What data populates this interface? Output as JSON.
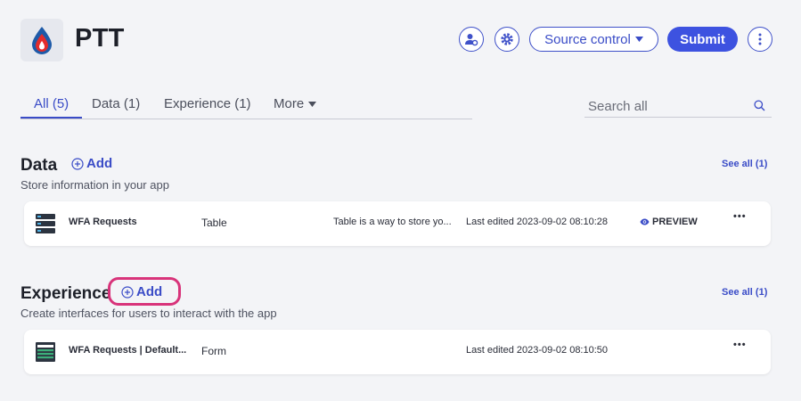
{
  "header": {
    "title": "PTT",
    "source_control_label": "Source control",
    "submit_label": "Submit"
  },
  "tabs": [
    {
      "label": "All (5)",
      "active": true
    },
    {
      "label": "Data (1)",
      "active": false
    },
    {
      "label": "Experience (1)",
      "active": false
    },
    {
      "label": "More",
      "active": false
    }
  ],
  "search": {
    "placeholder": "Search all"
  },
  "data_section": {
    "title": "Data",
    "add_label": "Add",
    "description": "Store information in your app",
    "see_all": "See all (1)",
    "items": [
      {
        "name": "WFA Requests",
        "type": "Table",
        "description": "Table is a way to store yo...",
        "edited": "Last edited 2023-09-02 08:10:28",
        "preview_label": "PREVIEW",
        "more": "•••"
      }
    ]
  },
  "experience_section": {
    "title": "Experience",
    "add_label": "Add",
    "description": "Create interfaces for users to interact with the app",
    "see_all": "See all (1)",
    "items": [
      {
        "name": "WFA Requests | Default...",
        "type": "Form",
        "edited": "Last edited 2023-09-02 08:10:50",
        "more": "•••"
      }
    ]
  },
  "colors": {
    "accent": "#3a4cc7",
    "submit": "#3d52e0",
    "highlight": "#d8337a",
    "background": "#f3f4f7"
  }
}
